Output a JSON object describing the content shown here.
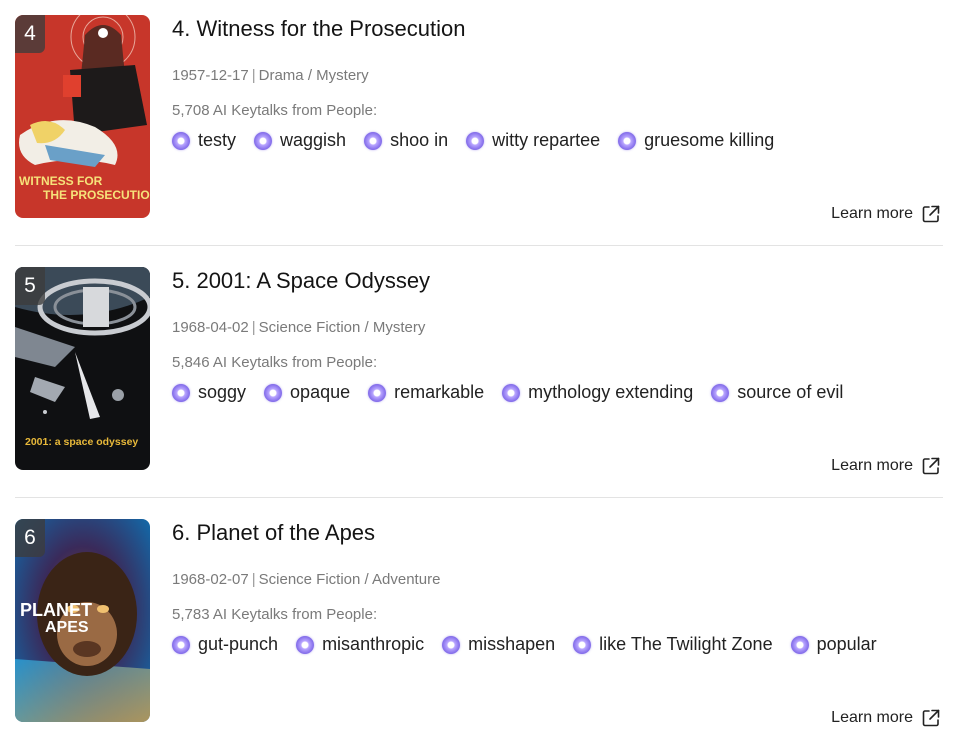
{
  "items": [
    {
      "rank": "4",
      "title": "4. Witness for the Prosecution",
      "date": "1957-12-17",
      "genres": "Drama / Mystery",
      "keytalk_count": "5,708 AI Keytalks from People:",
      "tags": [
        "testy",
        "waggish",
        "shoo in",
        "witty repartee",
        "gruesome killing"
      ],
      "learn_more": "Learn more",
      "poster_text": "WITNESS FOR THE PROSECUTION"
    },
    {
      "rank": "5",
      "title": "5. 2001: A Space Odyssey",
      "date": "1968-04-02",
      "genres": "Science Fiction / Mystery",
      "keytalk_count": "5,846 AI Keytalks from People:",
      "tags": [
        "soggy",
        "opaque",
        "remarkable",
        "mythology extending",
        "source of evil"
      ],
      "learn_more": "Learn more",
      "poster_text": "2001: a space odyssey"
    },
    {
      "rank": "6",
      "title": "6. Planet of the Apes",
      "date": "1968-02-07",
      "genres": "Science Fiction / Adventure",
      "keytalk_count": "5,783 AI Keytalks from People:",
      "tags": [
        "gut-punch",
        "misanthropic",
        "misshapen",
        "like The Twilight Zone",
        "popular"
      ],
      "learn_more": "Learn more",
      "poster_text": "PLANET OF THE APES"
    }
  ],
  "separator": "|",
  "icons": {
    "tag": "keytalk-orb-icon",
    "learn_more": "external-link-icon"
  },
  "colors": {
    "tag_icon": "#7f68e8",
    "meta_text": "#7a7a7a",
    "divider": "#e3e3e3"
  }
}
